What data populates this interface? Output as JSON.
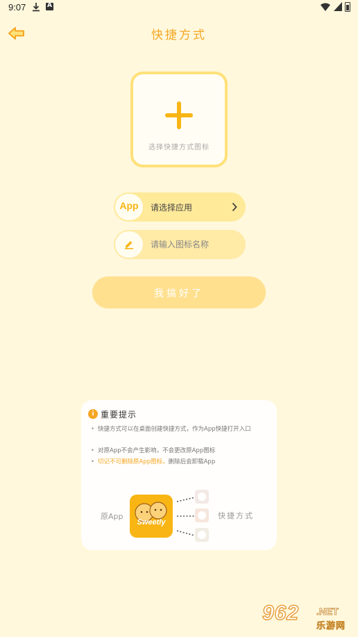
{
  "status_bar": {
    "time": "9:07",
    "icons": [
      "download-icon",
      "a-badge-icon",
      "wifi-icon",
      "signal-icon",
      "battery-icon"
    ]
  },
  "header": {
    "title": "快捷方式",
    "back_icon": "back-arrow-icon"
  },
  "icon_picker": {
    "label": "选择快捷方式图标"
  },
  "app_select": {
    "badge": "App",
    "label": "请选择应用"
  },
  "name_input": {
    "placeholder": "请输入图标名称",
    "value": ""
  },
  "submit": {
    "label": "我搞好了"
  },
  "tips": {
    "title": "重要提示",
    "items": [
      "快捷方式可以在桌面创建快捷方式，作为App快捷打开入口",
      "对原App不会产生影响，不会更改原App图标"
    ],
    "warning_highlight": "切记不可删除原App图标，",
    "warning_rest": "删除后会卸载App",
    "illustration": {
      "original_label": "原App",
      "app_name": "Sweetly",
      "shortcut_label": "快捷方式"
    }
  },
  "watermark": {
    "number": "962",
    "domain": ".NET",
    "cn": "乐游网"
  },
  "colors": {
    "background": "#fff8dc",
    "accent": "#f8b514",
    "title": "#f5a623",
    "pill": "#ffea9a",
    "button": "#ffe08f"
  }
}
